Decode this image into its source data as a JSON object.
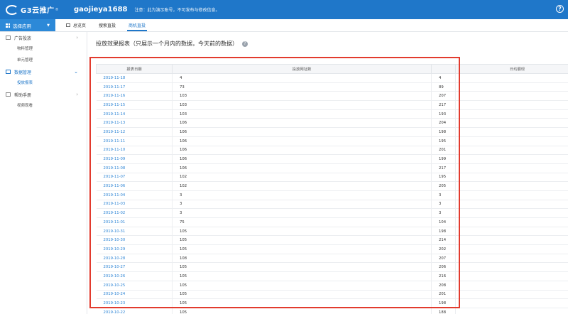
{
  "header": {
    "logo_text": "G3云推广",
    "logo_sup": "®",
    "username": "gaojieya1688",
    "notice": "注意：此为演示账号，不可发布与修改信息。",
    "help_glyph": "?"
  },
  "subbar": {
    "app_select_label": "选择应用",
    "tabs": [
      {
        "label": "总览页",
        "active": false
      },
      {
        "label": "搜索直投",
        "active": false
      },
      {
        "label": "商机直投",
        "active": true
      }
    ]
  },
  "sidebar": {
    "groups": [
      {
        "label": "广告投放",
        "open": false,
        "items": [
          "物料管理",
          "单元管理"
        ]
      },
      {
        "label": "数据管理",
        "open": true,
        "items": [
          "投放报表"
        ]
      },
      {
        "label": "帮助手册",
        "open": false,
        "items": [
          "视频观看"
        ]
      }
    ]
  },
  "main": {
    "title": "投放效果报表（只展示一个月内的数据，今天前的数据）",
    "help_glyph": "?",
    "table": {
      "columns": [
        "报表日期",
        "投放网址数",
        "",
        "日均展现"
      ],
      "rows": [
        [
          "2019-11-18",
          "4",
          "4"
        ],
        [
          "2019-11-17",
          "73",
          "89"
        ],
        [
          "2019-11-16",
          "103",
          "207"
        ],
        [
          "2019-11-15",
          "103",
          "217"
        ],
        [
          "2019-11-14",
          "103",
          "193"
        ],
        [
          "2019-11-13",
          "106",
          "204"
        ],
        [
          "2019-11-12",
          "106",
          "198"
        ],
        [
          "2019-11-11",
          "106",
          "195"
        ],
        [
          "2019-11-10",
          "106",
          "201"
        ],
        [
          "2019-11-09",
          "106",
          "199"
        ],
        [
          "2019-11-08",
          "106",
          "217"
        ],
        [
          "2019-11-07",
          "102",
          "195"
        ],
        [
          "2019-11-06",
          "102",
          "205"
        ],
        [
          "2019-11-04",
          "3",
          "3"
        ],
        [
          "2019-11-03",
          "3",
          "3"
        ],
        [
          "2019-11-02",
          "3",
          "3"
        ],
        [
          "2019-11-01",
          "75",
          "104"
        ],
        [
          "2019-10-31",
          "105",
          "198"
        ],
        [
          "2019-10-30",
          "105",
          "214"
        ],
        [
          "2019-10-29",
          "105",
          "202"
        ],
        [
          "2019-10-28",
          "108",
          "207"
        ],
        [
          "2019-10-27",
          "105",
          "206"
        ],
        [
          "2019-10-26",
          "105",
          "216"
        ],
        [
          "2019-10-25",
          "105",
          "208"
        ],
        [
          "2019-10-24",
          "105",
          "201"
        ],
        [
          "2019-10-23",
          "105",
          "198"
        ],
        [
          "2019-10-22",
          "105",
          "188"
        ]
      ]
    }
  },
  "colors": {
    "brand": "#1f77c9",
    "link": "#2f86d6",
    "highlight": "#e23b2e"
  }
}
